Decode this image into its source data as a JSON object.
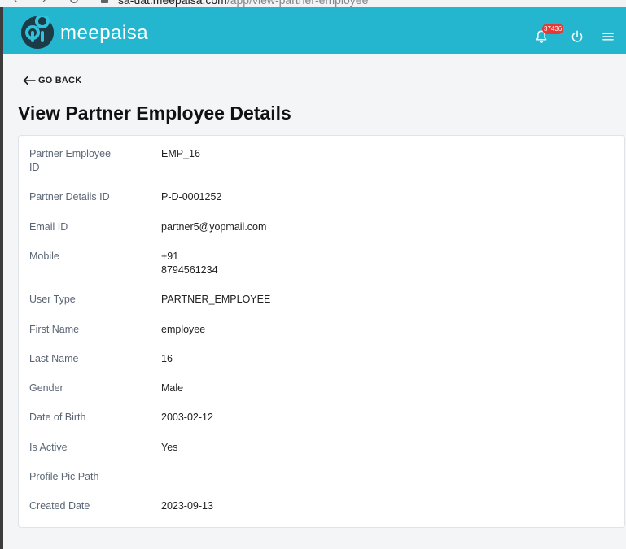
{
  "browser": {
    "url_host": "sa-uat.meepaisa.com",
    "url_path": "/app/view-partner-employee"
  },
  "header": {
    "brand": "meepaisa",
    "notification_count": "37436",
    "colors": {
      "topbar": "#24b5cf",
      "badge": "#e53935",
      "logo_bg": "#1d3b47"
    },
    "icons": [
      "bell-icon",
      "power-icon",
      "menu-icon"
    ]
  },
  "nav": {
    "go_back_label": "GO BACK"
  },
  "page": {
    "title": "View Partner Employee Details"
  },
  "details": {
    "partner_employee_id": {
      "label_line1": "Partner Employee",
      "label_line2": "ID",
      "value": "EMP_16"
    },
    "partner_details_id": {
      "label": "Partner Details ID",
      "value": "P-D-0001252"
    },
    "email_id": {
      "label": "Email ID",
      "value": "partner5@yopmail.com"
    },
    "mobile": {
      "label": "Mobile",
      "value_line1": "+91",
      "value_line2": "8794561234"
    },
    "user_type": {
      "label": "User Type",
      "value": "PARTNER_EMPLOYEE"
    },
    "first_name": {
      "label": "First Name",
      "value": "employee"
    },
    "last_name": {
      "label": "Last Name",
      "value": "16"
    },
    "gender": {
      "label": "Gender",
      "value": "Male"
    },
    "date_of_birth": {
      "label": "Date of Birth",
      "value": "2003-02-12"
    },
    "is_active": {
      "label": "Is Active",
      "value": "Yes"
    },
    "profile_pic_path": {
      "label": "Profile Pic Path",
      "value": ""
    },
    "created_date": {
      "label": "Created Date",
      "value": "2023-09-13"
    }
  }
}
